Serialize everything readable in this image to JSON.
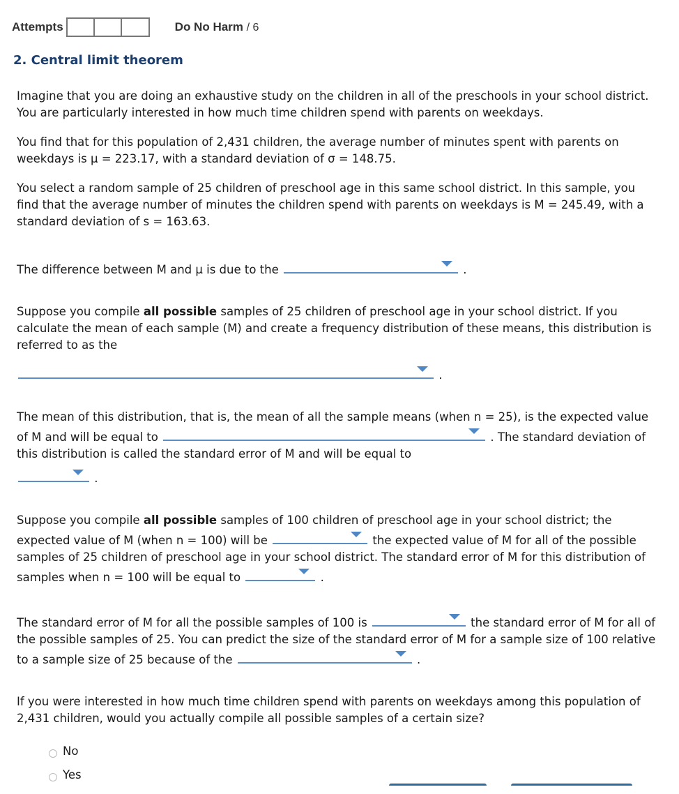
{
  "header": {
    "attempts_label": "Attempts",
    "attempt_count_boxes": 3,
    "score_label": "Do No Harm",
    "score_total": "/ 6"
  },
  "question": {
    "title": "2. Central limit theorem",
    "intro": [
      "Imagine that you are doing an exhaustive study on the children in all of the preschools in your school district. You are particularly interested in how much time children spend with parents on weekdays.",
      "You find that for this population of 2,431 children, the average number of minutes spent with parents on weekdays is μ = 223.17, with a standard deviation of σ = 148.75.",
      "You select a random sample of 25 children of preschool age in this same school district. In this sample, you find that the average number of minutes the children spend with parents on weekdays is M = 245.49, with a standard deviation of s = 163.63."
    ],
    "q1": {
      "before": "The difference between M and μ is due to the",
      "after": "."
    },
    "q2": {
      "before_1": "Suppose you compile ",
      "bold": "all possible",
      "before_2": " samples of 25 children of preschool age in your school district. If you calculate the mean of each sample (M) and create a frequency distribution of these means, this distribution is referred to as the",
      "after": "."
    },
    "q3": {
      "before": "The mean of this distribution, that is, the mean of all the sample means (when n = 25), is the expected value of M and will be equal to",
      "middle": ". The standard deviation of this distribution is called the standard error of M and will be equal to",
      "after": "."
    },
    "q4": {
      "before_1": "Suppose you compile ",
      "bold": "all possible",
      "before_2": " samples of 100 children of preschool age in your school district; the expected value of M (when n = 100) will be",
      "middle": "the expected value of M for all of the possible samples of 25 children of preschool age in your school district. The standard error of M for this distribution of samples when n = 100 will be equal to",
      "after": "."
    },
    "q5": {
      "before": "The standard error of M for all the possible samples of 100 is",
      "middle": "the standard error of M for all of the possible samples of 25. You can predict the size of the standard error of M for a sample size of 100 relative to a sample size of 25 because of the",
      "after": "."
    },
    "q6": {
      "text": "If you were interested in how much time children spend with parents on weekdays among this population of 2,431 children, would you actually compile all possible samples of a certain size?",
      "options": [
        "No",
        "Yes"
      ]
    },
    "dropdown_values": [
      "",
      "",
      "",
      "",
      "",
      "",
      "",
      ""
    ]
  }
}
